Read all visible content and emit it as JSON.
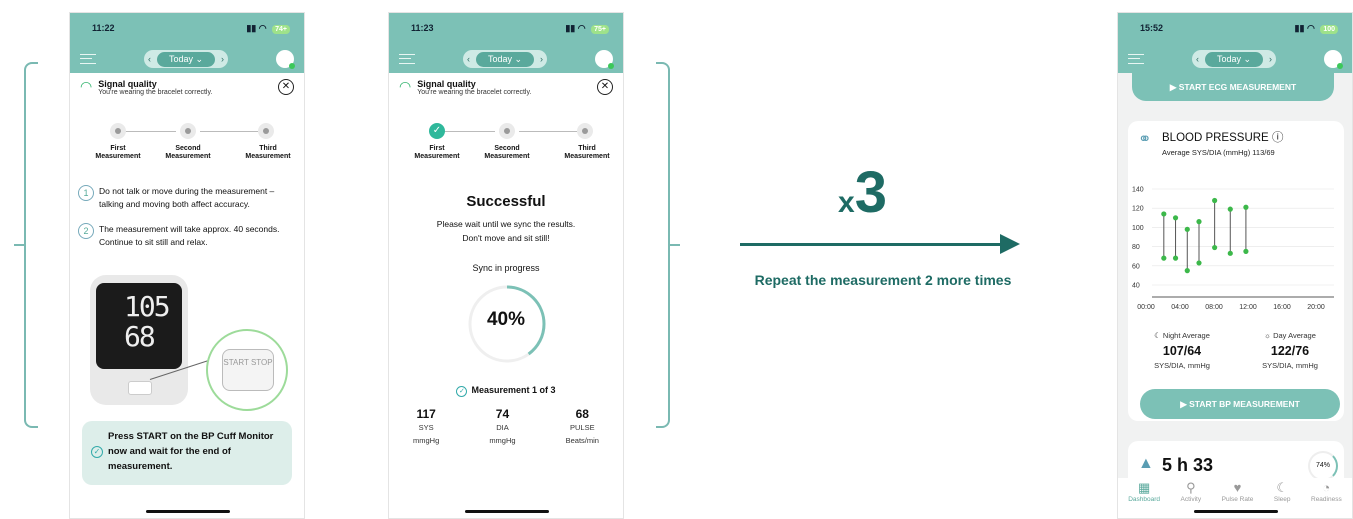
{
  "phone1": {
    "time": "11:22",
    "battery": "74+",
    "day": "Today",
    "signal_title": "Signal quality",
    "signal_sub": "You're wearing the bracelet correctly.",
    "steps": [
      "First Measurement",
      "Second Measurement",
      "Third Measurement"
    ],
    "instruction1": "Do not talk or move during the measurement – talking and moving both affect accuracy.",
    "instruction2": "The measurement will take approx. 40 seconds. Continue to sit still and relax.",
    "monitor_sys": "105",
    "monitor_dia": "68",
    "button_label": "START STOP",
    "notice": "Press START on the BP Cuff Monitor now and wait for the end of measurement."
  },
  "phone2": {
    "time": "11:23",
    "battery": "75+",
    "day": "Today",
    "signal_title": "Signal quality",
    "signal_sub": "You're wearing the bracelet correctly.",
    "steps": [
      "First Measurement",
      "Second Measurement",
      "Third Measurement"
    ],
    "heading": "Successful",
    "sub1": "Please wait until we sync the results.",
    "sub2": "Don't move and sit still!",
    "sync_label": "Sync in progress",
    "progress_label": "40%",
    "progress_fraction": 0.4,
    "measurement_of": "Measurement 1 of 3",
    "values": [
      {
        "value": "117",
        "label": "SYS",
        "unit": "mmgHg"
      },
      {
        "value": "74",
        "label": "DIA",
        "unit": "mmgHg"
      },
      {
        "value": "68",
        "label": "PULSE",
        "unit": "Beats/min"
      }
    ]
  },
  "middle": {
    "x_text": "x",
    "count_text": "3",
    "repeat_text": "Repeat the measurement 2 more times"
  },
  "phone3": {
    "time": "15:52",
    "battery": "100",
    "day": "Today",
    "ecg_button": "START ECG MEASUREMENT",
    "bp_title": "BLOOD PRESSURE",
    "bp_subtitle": "Average SYS/DIA (mmHg) 113/69",
    "night_label": "Night Average",
    "night_value": "107/64",
    "day_label": "Day Average",
    "day_value": "122/76",
    "unit": "SYS/DIA, mmHg",
    "bp_button": "START BP MEASUREMENT",
    "next_value": "5 h 33",
    "next_pct": "74%",
    "tabs": [
      "Dashboard",
      "Activity",
      "Pulse Rate",
      "Sleep",
      "Readiness"
    ]
  },
  "chart_data": {
    "type": "scatter",
    "title": "BLOOD PRESSURE",
    "ylim": [
      40,
      140
    ],
    "y_ticks": [
      140,
      120,
      100,
      80,
      60,
      40
    ],
    "x_ticks": [
      "00:00",
      "04:00",
      "08:00",
      "12:00",
      "16:00",
      "20:00"
    ],
    "series": [
      {
        "x_hour": 1.0,
        "sys": 114,
        "dia": 68
      },
      {
        "x_hour": 2.5,
        "sys": 110,
        "dia": 68
      },
      {
        "x_hour": 4.0,
        "sys": 98,
        "dia": 55
      },
      {
        "x_hour": 5.5,
        "sys": 106,
        "dia": 63
      },
      {
        "x_hour": 7.5,
        "sys": 128,
        "dia": 79
      },
      {
        "x_hour": 9.5,
        "sys": 119,
        "dia": 73
      },
      {
        "x_hour": 11.5,
        "sys": 121,
        "dia": 75
      }
    ],
    "grid": true
  },
  "colors": {
    "accent": "#7cc1b6",
    "dark_teal": "#1e6b64",
    "point": "#3cb84a"
  }
}
